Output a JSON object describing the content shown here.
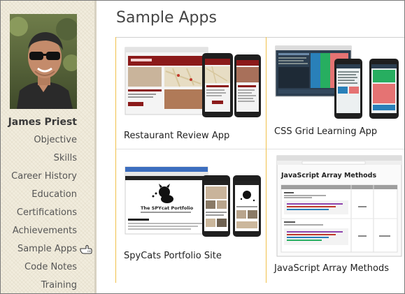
{
  "profile": {
    "name": "James Priest"
  },
  "nav": {
    "items": [
      "Objective",
      "Skills",
      "Career History",
      "Education",
      "Certifications",
      "Achievements",
      "Sample Apps",
      "Code Notes",
      "Training"
    ],
    "hovered": "Sample Apps"
  },
  "main": {
    "title": "Sample Apps",
    "cards": [
      {
        "title": "Restaurant Review App"
      },
      {
        "title": "CSS Grid Learning App"
      },
      {
        "title": "SpyCats Portfolio Site"
      },
      {
        "title": "JavaScript Array Methods"
      }
    ]
  },
  "thumbs": {
    "jsarray": {
      "heading": "JavaScript Array Methods"
    },
    "spycats": {
      "heading": "The SPYcat Portfolio"
    }
  },
  "colors": {
    "sidebar_bg": "#f1ecdd",
    "accent_gold": "#f0c14b",
    "restaurant_red": "#8b1a1a",
    "title_text": "#444444"
  },
  "icons": {
    "pointer": "hand-pointer-icon"
  }
}
